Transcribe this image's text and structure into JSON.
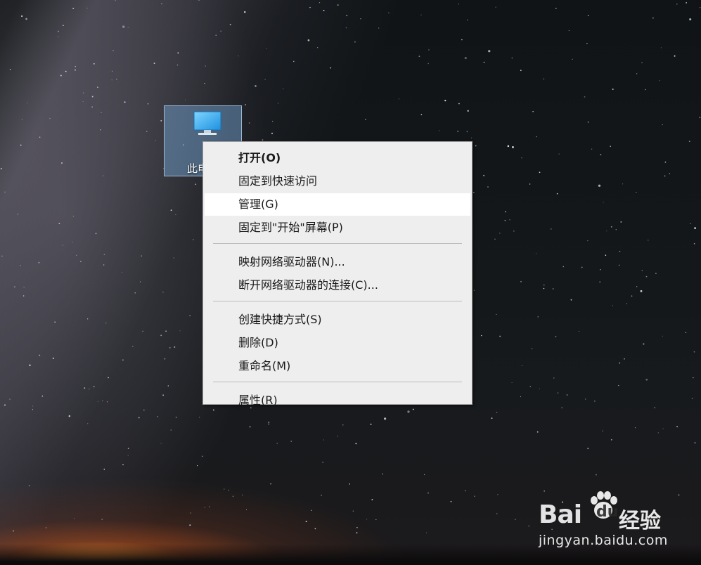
{
  "desktop": {
    "icon_label": "此电脑",
    "icon": "this-pc-monitor-icon"
  },
  "context_menu": {
    "sections": [
      [
        {
          "label": "打开(O)",
          "bold": true
        },
        {
          "label": "固定到快速访问"
        },
        {
          "label": "管理(G)",
          "hovered": true
        },
        {
          "label": "固定到\"开始\"屏幕(P)"
        }
      ],
      [
        {
          "label": "映射网络驱动器(N)..."
        },
        {
          "label": "断开网络驱动器的连接(C)..."
        }
      ],
      [
        {
          "label": "创建快捷方式(S)"
        },
        {
          "label": "删除(D)"
        },
        {
          "label": "重命名(M)"
        }
      ],
      [
        {
          "label": "属性(R)"
        }
      ]
    ]
  },
  "watermark": {
    "brand": "Bai",
    "brand_du": "du",
    "product": "经验",
    "url": "jingyan.baidu.com"
  },
  "colors": {
    "menu_background": "#eeeeee",
    "menu_hover": "#ffffff",
    "icon_selection": "#78aadc"
  }
}
